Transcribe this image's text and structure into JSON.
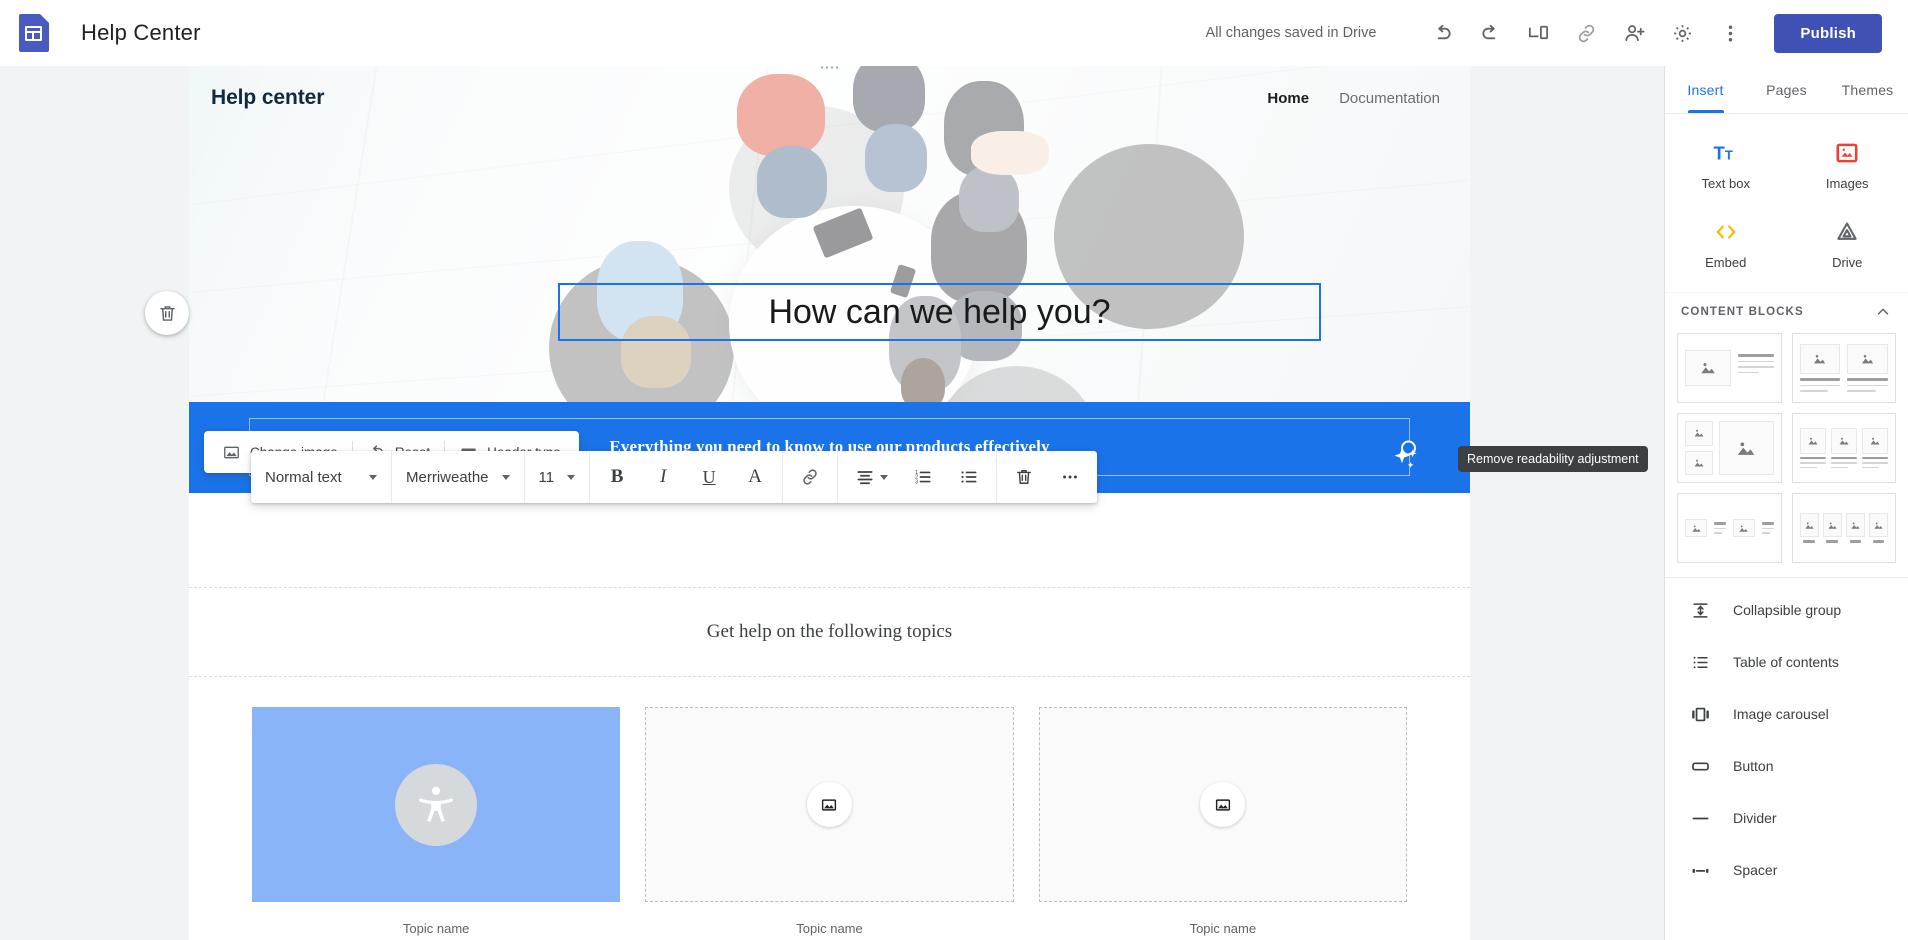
{
  "appbar": {
    "logo_icon": "google-sites-logo",
    "doc_title": "Help Center",
    "save_status": "All changes saved in Drive",
    "undo_icon": "undo-icon",
    "redo_icon": "redo-icon",
    "preview_icon": "preview-devices-icon",
    "link_icon": "link-icon",
    "share_icon": "add-person-icon",
    "settings_icon": "gear-icon",
    "more_icon": "more-vertical-icon",
    "publish_label": "Publish",
    "publish_color": "#3f51b5"
  },
  "right_panel": {
    "tabs": [
      {
        "label": "Insert",
        "active": true
      },
      {
        "label": "Pages",
        "active": false
      },
      {
        "label": "Themes",
        "active": false
      }
    ],
    "insert_items": [
      {
        "label": "Text box",
        "icon": "text-box-icon",
        "color": "#1a73e8"
      },
      {
        "label": "Images",
        "icon": "images-icon",
        "color": "#ea4335"
      },
      {
        "label": "Embed",
        "icon": "embed-code-icon",
        "color": "#fbbc04"
      },
      {
        "label": "Drive",
        "icon": "google-drive-icon",
        "color": "#5f6368"
      }
    ],
    "content_blocks_title": "CONTENT BLOCKS",
    "collapse_icon": "chevron-up-icon",
    "content_blocks": [
      {
        "name": "image-left-text-right-block"
      },
      {
        "name": "two-image-columns-block"
      },
      {
        "name": "two-small-one-large-image-block"
      },
      {
        "name": "three-image-columns-block"
      },
      {
        "name": "two-image-text-pairs-block"
      },
      {
        "name": "four-image-columns-block"
      }
    ],
    "list_items": [
      {
        "label": "Collapsible group",
        "icon": "collapsible-group-icon"
      },
      {
        "label": "Table of contents",
        "icon": "table-of-contents-icon"
      },
      {
        "label": "Image carousel",
        "icon": "image-carousel-icon"
      },
      {
        "label": "Button",
        "icon": "button-icon"
      },
      {
        "label": "Divider",
        "icon": "divider-icon"
      },
      {
        "label": "Spacer",
        "icon": "spacer-icon"
      }
    ]
  },
  "header_controls": {
    "change_image_label": "Change image",
    "change_image_icon": "image-icon",
    "reset_label": "Reset",
    "reset_icon": "reset-undo-icon",
    "header_type_label": "Header type",
    "header_type_icon": "banner-icon"
  },
  "readability": {
    "sparkle_icon": "sparkle-stars-icon",
    "tooltip": "Remove readability adjustment"
  },
  "hero_delete": {
    "icon": "trash-icon"
  },
  "site": {
    "name": "Help center",
    "nav": [
      {
        "label": "Home",
        "active": true
      },
      {
        "label": "Documentation",
        "active": false
      }
    ],
    "hero_title": "How can we help you?",
    "banner_text": "Everything you need to know to use our products effectively",
    "banner_color": "#1a73e8",
    "topics_heading": "Get help on the following topics",
    "cards": [
      {
        "label": "Topic name",
        "state": "filled",
        "icon": "accessibility-person-icon",
        "bg": "#8ab4f8"
      },
      {
        "label": "Topic name",
        "state": "empty",
        "icon": "image-placeholder-icon"
      },
      {
        "label": "Topic name",
        "state": "empty",
        "icon": "image-placeholder-icon"
      }
    ]
  },
  "text_toolbar": {
    "style_value": "Normal text",
    "font_value": "Merriweathe",
    "size_value": "11",
    "bold_label": "B",
    "italic_label": "I",
    "underline_label": "U",
    "text_color_label": "A",
    "link_icon": "link-icon",
    "align_icon": "align-center-icon",
    "numbered_list_icon": "numbered-list-icon",
    "bulleted_list_icon": "bulleted-list-icon",
    "delete_icon": "trash-icon",
    "more_icon": "more-horizontal-icon"
  }
}
